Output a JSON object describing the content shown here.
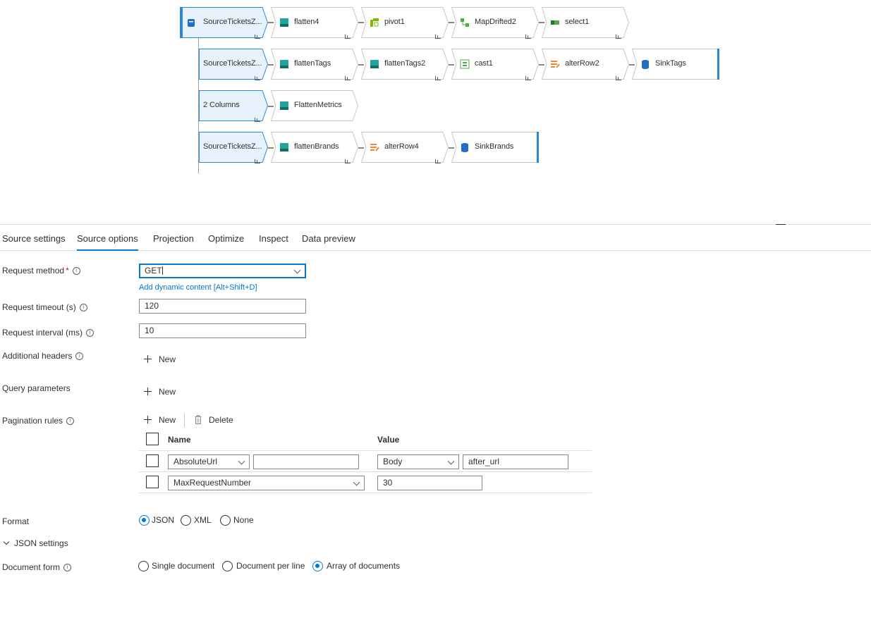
{
  "flow": {
    "rows": [
      {
        "source": "SourceTicketsZ...",
        "nodes": [
          "flatten4",
          "pivot1",
          "MapDrifted2",
          "select1"
        ]
      },
      {
        "source": "SourceTicketsZ...",
        "nodes": [
          "flattenTags",
          "flattenTags2",
          "cast1",
          "alterRow2",
          "SinkTags"
        ]
      },
      {
        "source": "2 Columns",
        "nodes": [
          "FlattenMetrics"
        ]
      },
      {
        "source": "SourceTicketsZ...",
        "nodes": [
          "flattenBrands",
          "alterRow4",
          "SinkBrands"
        ]
      }
    ]
  },
  "tabs": [
    "Source settings",
    "Source options",
    "Projection",
    "Optimize",
    "Inspect",
    "Data preview"
  ],
  "active_tab": "Source options",
  "form": {
    "request_method": {
      "label": "Request method",
      "required_mark": "*",
      "value": "GET",
      "dynamic_link": "Add dynamic content [Alt+Shift+D]"
    },
    "request_timeout": {
      "label": "Request timeout (s)",
      "value": "120"
    },
    "request_interval": {
      "label": "Request interval (ms)",
      "value": "10"
    },
    "additional_headers": {
      "label": "Additional headers",
      "new_label": "New"
    },
    "query_parameters": {
      "label": "Query parameters",
      "new_label": "New"
    },
    "pagination_rules": {
      "label": "Pagination rules",
      "new_label": "New",
      "delete_label": "Delete",
      "col_name": "Name",
      "col_value": "Value",
      "rows": [
        {
          "name": "AbsoluteUrl",
          "name_extra": "",
          "value_type": "Body",
          "value": "after_url"
        },
        {
          "name": "MaxRequestNumber",
          "value": "30"
        }
      ]
    },
    "format": {
      "label": "Format",
      "options": [
        "JSON",
        "XML",
        "None"
      ],
      "selected": "JSON"
    },
    "json_settings": {
      "label": "JSON settings"
    },
    "document_form": {
      "label": "Document form",
      "options": [
        "Single document",
        "Document per line",
        "Array of documents"
      ],
      "selected": "Array of documents"
    }
  },
  "icons": {
    "source": "source-icon",
    "flatten": "flatten-icon",
    "pivot": "pivot-icon",
    "map": "map-drifted-icon",
    "select": "select-icon",
    "cast": "cast-icon",
    "alterrow": "alter-row-icon",
    "sink": "sink-icon"
  },
  "colors": {
    "accent": "#0078d4",
    "flatten": "#20a59c",
    "alterrow": "#e8893a",
    "select": "#54a64a"
  }
}
